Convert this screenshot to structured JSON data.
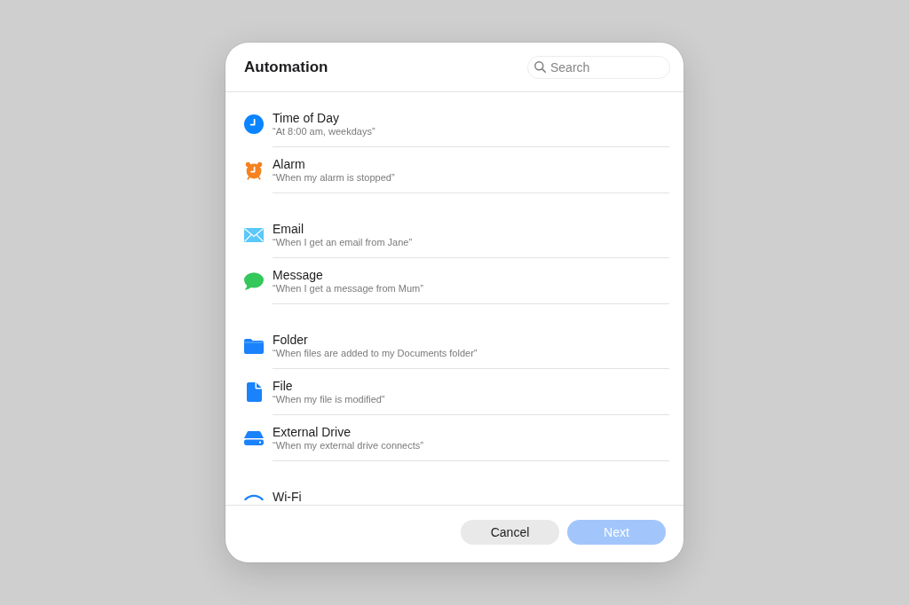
{
  "window": {
    "title": "Automation"
  },
  "search": {
    "placeholder": "Search"
  },
  "groups": [
    {
      "items": [
        {
          "kind": "clock",
          "title": "Time of Day",
          "subtitle": "“At 8:00 am, weekdays”"
        },
        {
          "kind": "alarm",
          "title": "Alarm",
          "subtitle": "“When my alarm is stopped”"
        }
      ]
    },
    {
      "items": [
        {
          "kind": "email",
          "title": "Email",
          "subtitle": "“When I get an email from Jane”"
        },
        {
          "kind": "message",
          "title": "Message",
          "subtitle": "“When I get a message from Mum”"
        }
      ]
    },
    {
      "items": [
        {
          "kind": "folder",
          "title": "Folder",
          "subtitle": "“When files are added to my Documents folder”"
        },
        {
          "kind": "file",
          "title": "File",
          "subtitle": "“When my file is modified”"
        },
        {
          "kind": "drive",
          "title": "External Drive",
          "subtitle": "“When my external drive connects”"
        }
      ]
    },
    {
      "items": [
        {
          "kind": "wifi",
          "title": "Wi-Fi"
        }
      ]
    }
  ],
  "buttons": [
    {
      "kind": "secondary",
      "label": "Cancel",
      "disabled": false
    },
    {
      "kind": "primary",
      "label": "Next",
      "disabled": true
    }
  ]
}
